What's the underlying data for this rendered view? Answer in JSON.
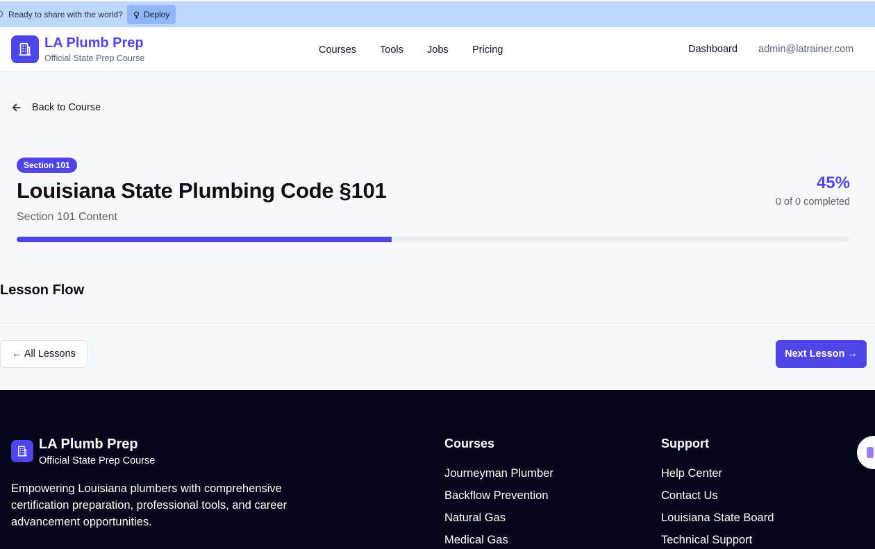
{
  "deploy_bar": {
    "message": "Ready to share with the world?",
    "button_label": "Deploy"
  },
  "header": {
    "brand_title": "LA Plumb Prep",
    "brand_subtitle": "Official State Prep Course",
    "nav": [
      "Courses",
      "Tools",
      "Jobs",
      "Pricing"
    ],
    "dashboard_label": "Dashboard",
    "user_email": "admin@latrainer.com"
  },
  "back_link": "Back to Course",
  "lesson": {
    "badge": "Section 101",
    "title": "Louisiana State Plumbing Code §101",
    "subtitle": "Section 101 Content",
    "progress_percent_label": "45%",
    "progress_value": 45,
    "completed_text": "0 of 0 completed"
  },
  "lesson_flow_heading": "Lesson Flow",
  "buttons": {
    "all_lessons": "← All Lessons",
    "next_lesson": "Next Lesson →"
  },
  "footer": {
    "brand_title": "LA Plumb Prep",
    "brand_subtitle": "Official State Prep Course",
    "description": "Empowering Louisiana plumbers with comprehensive certification preparation, professional tools, and career advancement opportunities.",
    "courses_heading": "Courses",
    "courses": [
      "Journeyman Plumber",
      "Backflow Prevention",
      "Natural Gas",
      "Medical Gas"
    ],
    "support_heading": "Support",
    "support": [
      "Help Center",
      "Contact Us",
      "Louisiana State Board",
      "Technical Support"
    ]
  },
  "colors": {
    "accent": "#4f46e5",
    "deploy_bar": "#bfd7fc",
    "footer_bg": "#05061a"
  }
}
